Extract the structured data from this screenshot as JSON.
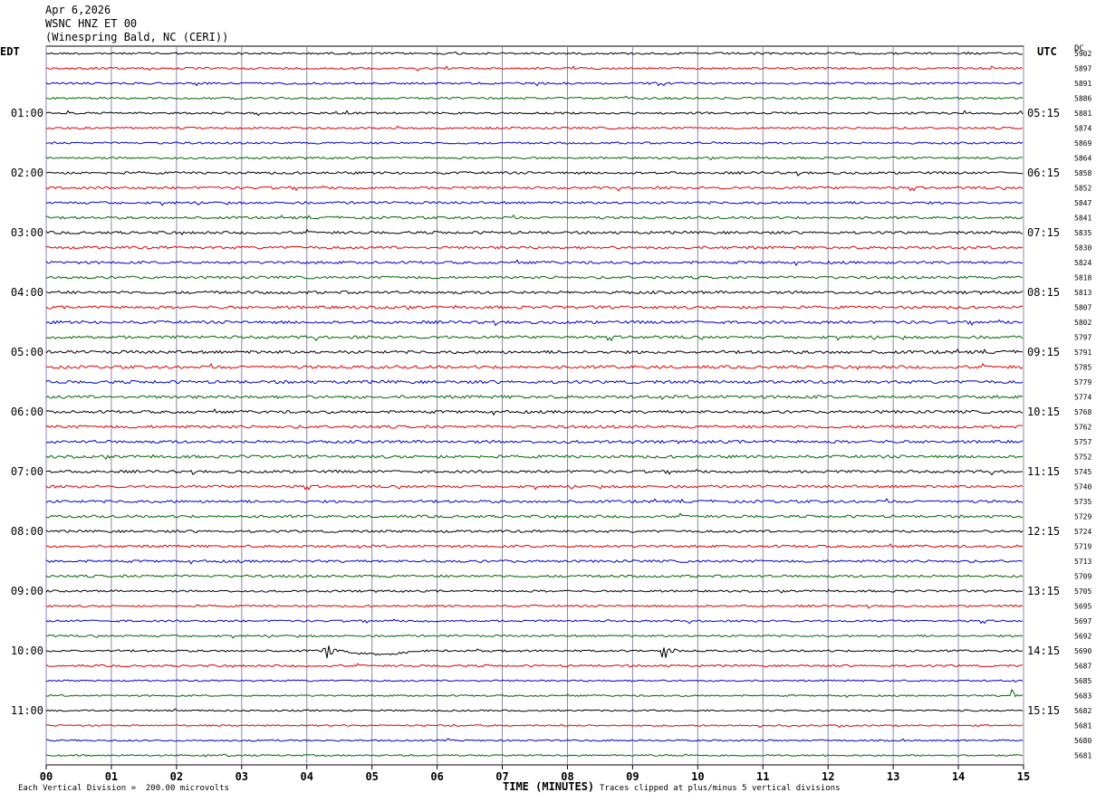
{
  "header": {
    "date": "Apr 6,2026",
    "station": "WSNC HNZ ET 00",
    "location": "(Winespring Bald, NC (CERI))"
  },
  "left_tz": "EDT",
  "right_tz": "UTC",
  "dc_header": "DC",
  "footer": {
    "scale": "Each Vertical Division =  200.00 microvolts",
    "xlabel": "TIME (MINUTES)",
    "clip": "Traces clipped at plus/minus 5 vertical divisions"
  },
  "colors": {
    "trace_cycle": [
      "#000000",
      "#e00000",
      "#0000cc",
      "#006600"
    ],
    "grid": "#8888aa",
    "background": "#ffffff"
  },
  "chart_data": {
    "type": "line",
    "subtype": "helicorder",
    "x_range_minutes": [
      0,
      15
    ],
    "x_ticks": [
      "00",
      "01",
      "02",
      "03",
      "04",
      "05",
      "06",
      "07",
      "08",
      "09",
      "10",
      "11",
      "12",
      "13",
      "14",
      "15"
    ],
    "xlabel": "TIME (MINUTES)",
    "rows_per_hour": 4,
    "left_hour_labels": [
      "01:00",
      "02:00",
      "03:00",
      "04:00",
      "05:00",
      "06:00",
      "07:00",
      "08:00",
      "09:00",
      "10:00",
      "11:00"
    ],
    "right_hour_labels": [
      "05:15",
      "06:15",
      "07:15",
      "08:15",
      "09:15",
      "10:15",
      "11:15",
      "12:15",
      "13:15",
      "14:15",
      "15:15"
    ],
    "dc_offsets": [
      5902,
      5897,
      5891,
      5886,
      5881,
      5874,
      5869,
      5864,
      5858,
      5852,
      5847,
      5841,
      5835,
      5830,
      5824,
      5818,
      5813,
      5807,
      5802,
      5797,
      5791,
      5785,
      5779,
      5774,
      5768,
      5762,
      5757,
      5752,
      5745,
      5740,
      5735,
      5729,
      5724,
      5719,
      5713,
      5709,
      5705,
      5695,
      5697,
      5692,
      5690,
      5687,
      5685,
      5683,
      5682,
      5681,
      5680,
      5681
    ],
    "noise_levels": [
      1,
      1,
      1,
      1,
      1,
      1,
      1,
      1,
      1.2,
      1.2,
      1.2,
      1.2,
      1.3,
      1.3,
      1.3,
      1.3,
      1.4,
      1.4,
      1.4,
      1.4,
      1.5,
      1.5,
      1.5,
      1.5,
      1.4,
      1.4,
      1.4,
      1.4,
      1.3,
      1.3,
      1.3,
      1.3,
      1.2,
      1.2,
      1.2,
      1.2,
      1,
      1,
      1,
      1,
      1,
      1,
      0.8,
      0.8,
      0.8,
      0.8,
      0.8,
      0.8
    ],
    "events": [
      {
        "row": 40,
        "minute": 4.3,
        "amplitude": 1.5
      },
      {
        "row": 40,
        "minute": 9.5,
        "amplitude": 1.2
      },
      {
        "row": 43,
        "minute": 14.85,
        "amplitude": 1.0
      }
    ],
    "grid": true
  }
}
